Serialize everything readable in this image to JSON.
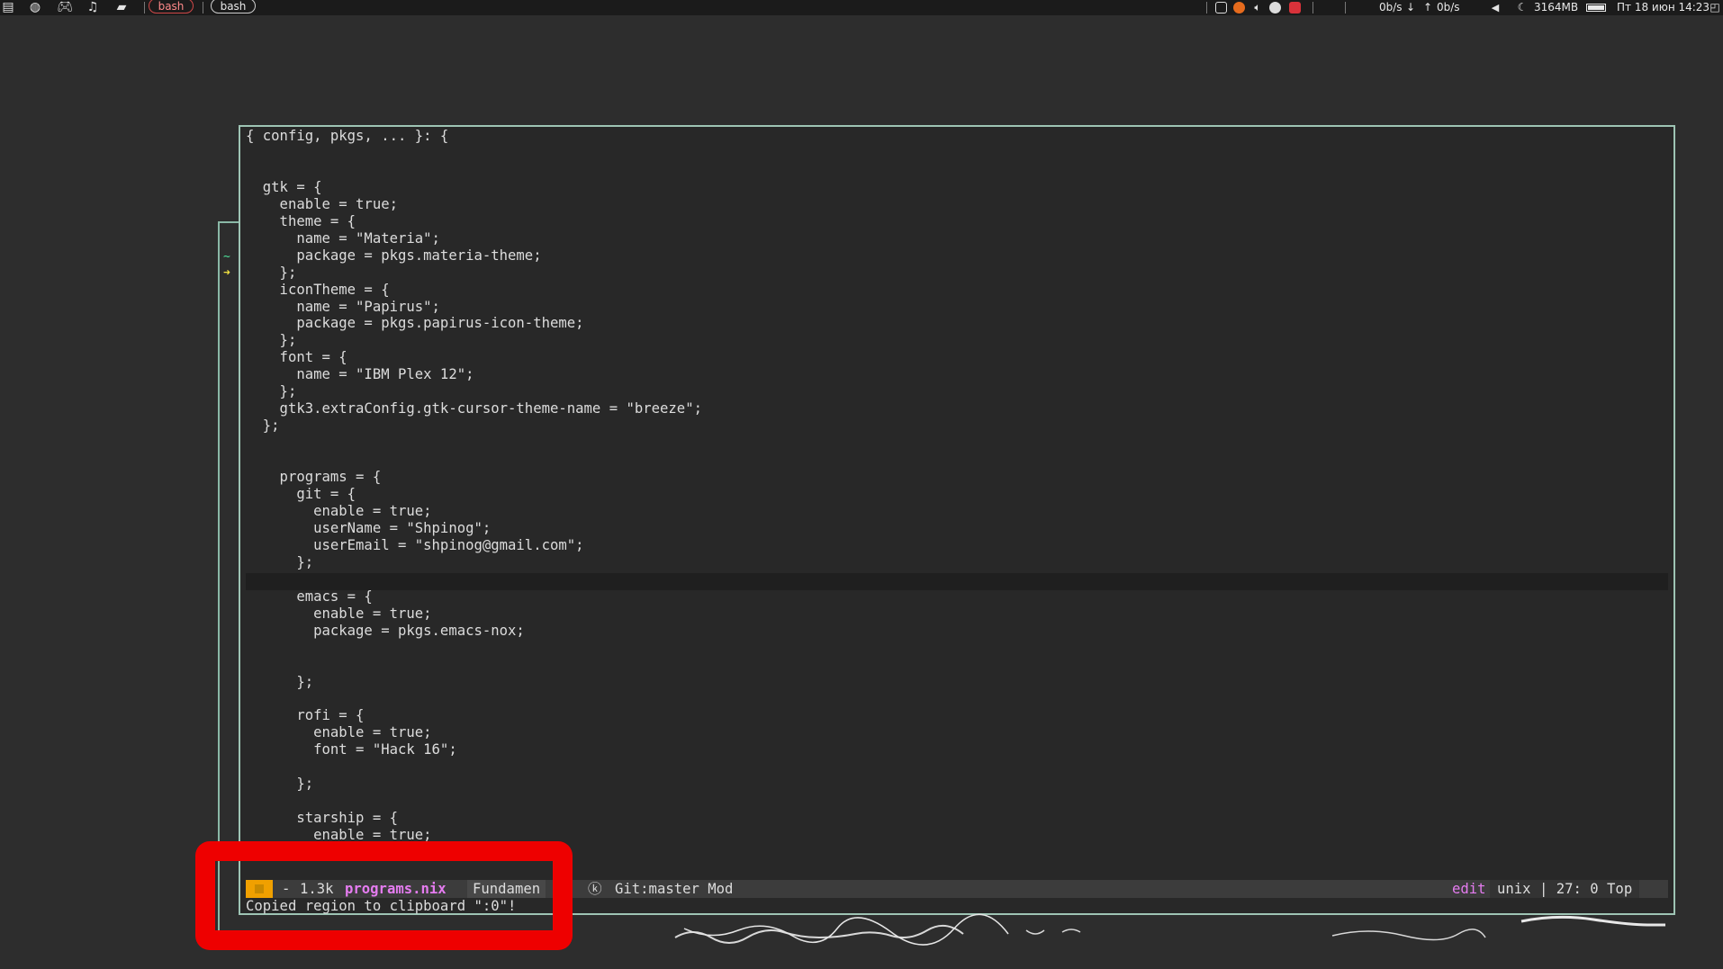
{
  "topbar": {
    "workspaces": [
      {
        "label": "bash",
        "active": true
      },
      {
        "label": "bash",
        "active": false
      }
    ],
    "launcher_icons": [
      "files-icon",
      "globe-icon",
      "gamepad-icon",
      "music-icon",
      "chat-icon"
    ],
    "tray_icons": [
      "window-icon",
      "firefox-icon",
      "volume-icon",
      "steam-icon",
      "telegram-icon"
    ],
    "net_down": "0b/s",
    "net_up": "0b/s",
    "memory": "3164MB",
    "datetime": "Пт 18 июн 14:23",
    "battery_level": 1.0,
    "colors": {
      "active_ws": "#d04848",
      "bar_bg": "#1b1b1b"
    }
  },
  "editor": {
    "code_lines": [
      "{ config, pkgs, ... }: {",
      "",
      "",
      "  gtk = {",
      "    enable = true;",
      "    theme = {",
      "      name = \"Materia\";",
      "      package = pkgs.materia-theme;",
      "    };",
      "    iconTheme = {",
      "      name = \"Papirus\";",
      "      package = pkgs.papirus-icon-theme;",
      "    };",
      "    font = {",
      "      name = \"IBM Plex 12\";",
      "    };",
      "    gtk3.extraConfig.gtk-cursor-theme-name = \"breeze\";",
      "  };",
      "",
      "",
      "    programs = {",
      "      git = {",
      "        enable = true;",
      "        userName = \"Shpinog\";",
      "        userEmail = \"shpinog@gmail.com\";",
      "      };",
      "",
      "      emacs = {",
      "        enable = true;",
      "        package = pkgs.emacs-nox;",
      "",
      "",
      "      };",
      "",
      "      rofi = {",
      "        enable = true;",
      "        font = \"Hack 16\";",
      "",
      "      };",
      "",
      "      starship = {",
      "        enable = true;"
    ],
    "current_line": 27,
    "modeline": {
      "dash": "-",
      "size": "1.3k",
      "filename": "programs.nix",
      "major_mode": "Fundamen",
      "k_symbol": "ⓚ",
      "git": "Git:master Mod",
      "evil_state": "edit",
      "rest": "unix | 27: 0  Top",
      "colors": {
        "state": "#f0a000",
        "filename": "#e57cf0",
        "edit": "#e57cf0"
      }
    },
    "echo_area": "Copied region to clipboard \":0\"!"
  },
  "term_behind": {
    "glyph1": "~",
    "glyph2": "➜"
  }
}
